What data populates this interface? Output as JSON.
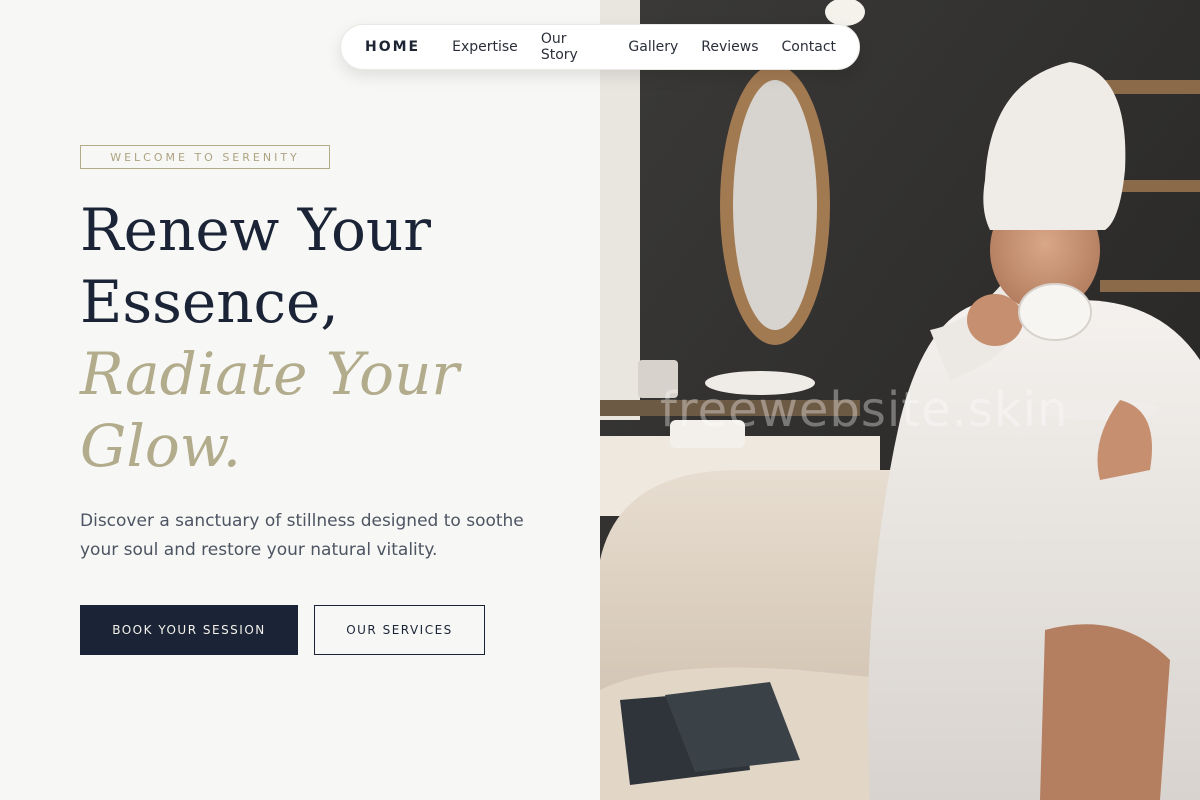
{
  "nav": {
    "home": "HOME",
    "items": [
      "Expertise",
      "Our Story",
      "Gallery",
      "Reviews",
      "Contact"
    ]
  },
  "hero": {
    "tagline": "WELCOME TO SERENITY",
    "headline_lines": [
      "Renew Your",
      "Essence,"
    ],
    "headline_accent_lines": [
      "Radiate Your",
      "Glow."
    ],
    "description": "Discover a sanctuary of stillness designed to soothe your soul and restore your natural vitality.",
    "primary_button": "BOOK YOUR SESSION",
    "secondary_button": "OUR SERVICES"
  },
  "photo": {
    "alt": "Woman in white robe and towel turban sipping from a cup in a spa lounge",
    "watermark": "freewebsite.skin"
  },
  "colors": {
    "navy": "#1b2437",
    "gold": "#b2ab8c",
    "background": "#f7f8f5"
  }
}
